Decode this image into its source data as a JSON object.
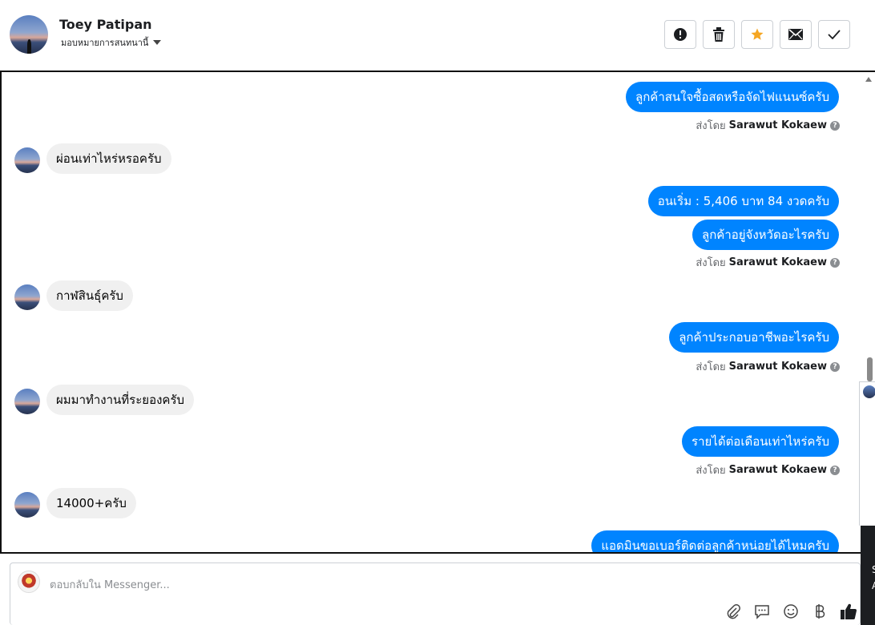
{
  "header": {
    "contact_name": "Toey Patipan",
    "assign_label": "มอบหมายการสนทนานี้"
  },
  "actions": [
    {
      "name": "mark-spam-button",
      "icon": "exclamation-icon"
    },
    {
      "name": "delete-button",
      "icon": "trash-icon"
    },
    {
      "name": "star-button",
      "icon": "star-icon"
    },
    {
      "name": "mark-unread-button",
      "icon": "envelope-icon"
    },
    {
      "name": "mark-done-button",
      "icon": "checkmark-icon"
    }
  ],
  "messages": {
    "out_1": "ลูกค้าสนใจซื้อสดหรือจัดไฟแนนซ์ครับ",
    "in_1": "ผ่อนเท่าไหร่หรอครับ",
    "out_2": "อนเริ่ม : 5,406 บาท 84 งวดครับ",
    "out_3": "ลูกค้าอยู่จังหวัดอะไรครับ",
    "in_2": "กาฬสินธุ์ครับ",
    "out_4": "ลูกค้าประกอบอาชีพอะไรครับ",
    "in_3": "ผมมาทำงานที่ระยองครับ",
    "out_5": "รายได้ต่อเดือนเท่าไหร่ครับ",
    "in_4": "14000+ครับ",
    "out_6": "แอดมินขอเบอร์ติดต่อลูกค้าหน่อยได้ไหมครับ"
  },
  "sent_by": {
    "prefix": "ส่งโดย",
    "agent": "Sarawut Kokaew",
    "help": "?"
  },
  "composer": {
    "placeholder": "ตอบกลับใน Messenger..."
  },
  "side_dark": {
    "line1": "S",
    "line2": "A"
  },
  "colors": {
    "outgoing_bubble": "#0084ff",
    "incoming_bubble": "#f0f0f0",
    "star": "#f5a623"
  }
}
